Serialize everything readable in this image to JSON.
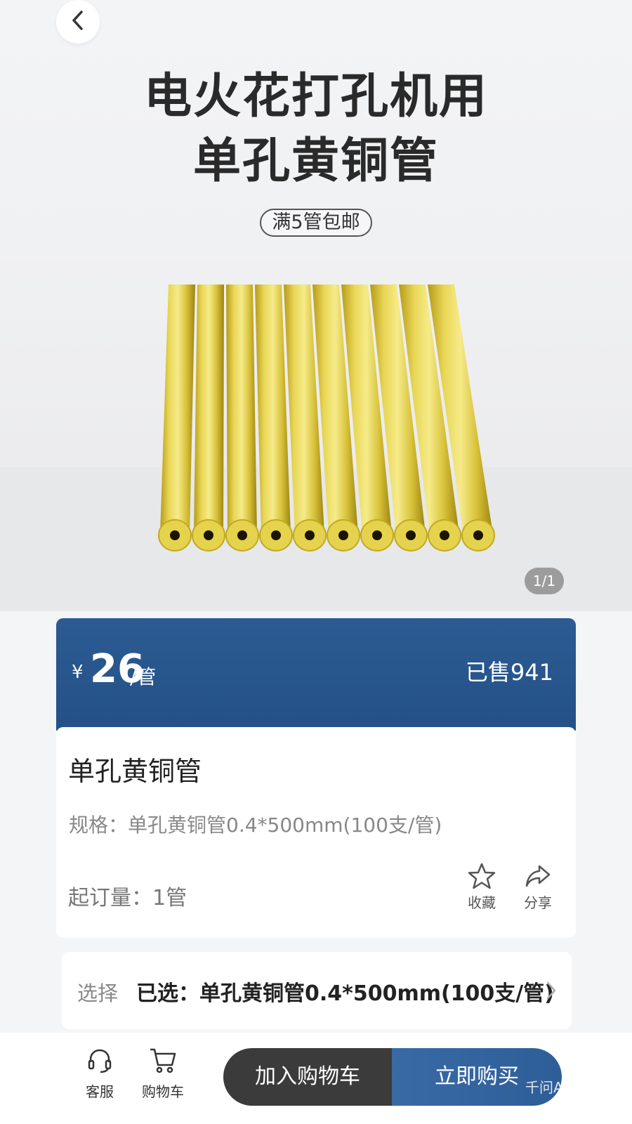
{
  "hero": {
    "headline_line1": "电火花打孔机用",
    "headline_line2": "单孔黄铜管",
    "promo": "满5管包邮",
    "page_indicator": "1/1"
  },
  "price": {
    "currency": "¥",
    "amount": "26",
    "unit": "/管",
    "sold": "已售941"
  },
  "product": {
    "name": "单孔黄铜管",
    "spec": "规格：单孔黄铜管0.4*500mm(100支/管)",
    "moq": "起订量：1管",
    "favorite_label": "收藏",
    "share_label": "分享"
  },
  "selection": {
    "label": "选择",
    "value": "已选：单孔黄铜管0.4*500mm(100支/管)"
  },
  "bottom_bar": {
    "service_label": "客服",
    "cart_label": "购物车",
    "add_to_cart": "加入购物车",
    "buy_now": "立即购买"
  },
  "watermark": "千问AI生成",
  "icons": {
    "back": "chevron-left-icon",
    "favorite": "star-icon",
    "share": "share-arrow-icon",
    "service": "headset-icon",
    "cart": "shopping-cart-icon",
    "chevron": "chevron-right-icon"
  },
  "colors": {
    "brand_blue": "#2c5b93",
    "cart_button": "#3b3b3b",
    "brass": "#d8c23a"
  }
}
